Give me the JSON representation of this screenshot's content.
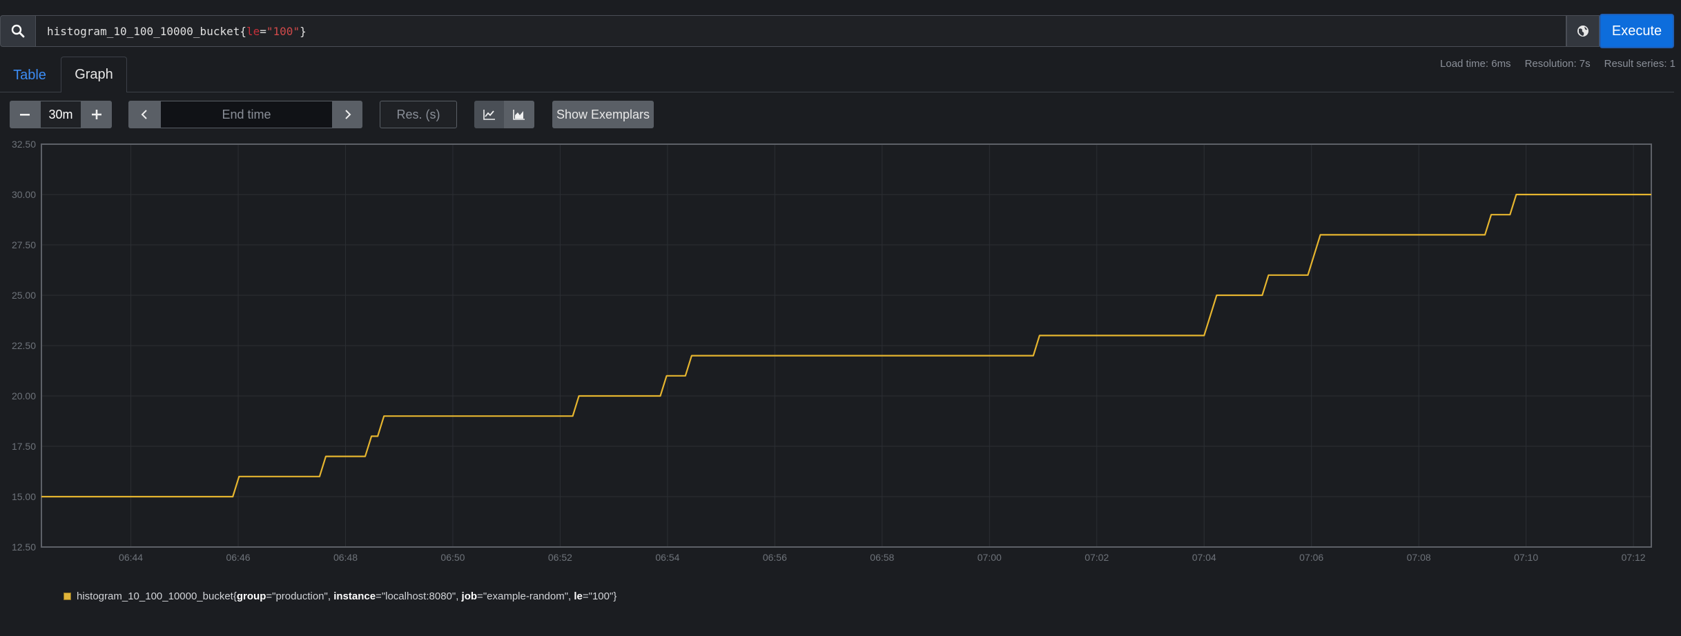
{
  "query": {
    "metric": "histogram_10_100_10000_bucket",
    "open_brace": "{",
    "label_name": "le",
    "equals": "=",
    "label_value": "\"100\"",
    "close_brace": "}"
  },
  "execute_label": "Execute",
  "tabs": [
    {
      "label": "Table"
    },
    {
      "label": "Graph"
    }
  ],
  "stats": {
    "load_time": "Load time: 6ms",
    "resolution": "Resolution: 7s",
    "result_series": "Result series: 1"
  },
  "controls": {
    "range": "30m",
    "end_time_placeholder": "End time",
    "resolution_placeholder": "Res. (s)",
    "exemplars_label": "Show Exemplars"
  },
  "colors": {
    "series": "#e6b52f",
    "accent": "#0d6ddc"
  },
  "chart_data": {
    "type": "line",
    "ylim": [
      12.5,
      32.5
    ],
    "yticks": [
      "12.50",
      "15.00",
      "17.50",
      "20.00",
      "22.50",
      "25.00",
      "27.50",
      "30.00",
      "32.50"
    ],
    "xticks": [
      "06:44",
      "06:46",
      "06:48",
      "06:50",
      "06:52",
      "06:54",
      "06:56",
      "06:58",
      "07:00",
      "07:02",
      "07:04",
      "07:06",
      "07:08",
      "07:10",
      "07:12"
    ],
    "x_start": "06:42:20",
    "x_end": "07:12:20",
    "grid": true,
    "series": [
      {
        "name": "histogram_10_100_10000_bucket{group=\"production\", instance=\"localhost:8080\", job=\"example-random\", le=\"100\"}",
        "points": [
          [
            "06:42:20",
            15
          ],
          [
            "06:45:54",
            15
          ],
          [
            "06:46:01",
            16
          ],
          [
            "06:47:31",
            16
          ],
          [
            "06:47:38",
            17
          ],
          [
            "06:48:22",
            17
          ],
          [
            "06:48:29",
            18
          ],
          [
            "06:48:36",
            18
          ],
          [
            "06:48:43",
            19
          ],
          [
            "06:52:14",
            19
          ],
          [
            "06:52:21",
            20
          ],
          [
            "06:53:52",
            20
          ],
          [
            "06:53:59",
            21
          ],
          [
            "06:54:20",
            21
          ],
          [
            "06:54:27",
            22
          ],
          [
            "07:00:49",
            22
          ],
          [
            "07:00:56",
            23
          ],
          [
            "07:04:00",
            23
          ],
          [
            "07:04:14",
            25
          ],
          [
            "07:05:05",
            25
          ],
          [
            "07:05:12",
            26
          ],
          [
            "07:05:56",
            26
          ],
          [
            "07:06:10",
            28
          ],
          [
            "07:09:14",
            28
          ],
          [
            "07:09:21",
            29
          ],
          [
            "07:09:42",
            29
          ],
          [
            "07:09:49",
            30
          ],
          [
            "07:12:20",
            30
          ]
        ]
      }
    ]
  },
  "legend": {
    "metric": "histogram_10_100_10000_bucket",
    "k1": "group",
    "v1": "\"production\"",
    "k2": "instance",
    "v2": "\"localhost:8080\"",
    "k3": "job",
    "v3": "\"example-random\"",
    "k4": "le",
    "v4": "\"100\""
  }
}
